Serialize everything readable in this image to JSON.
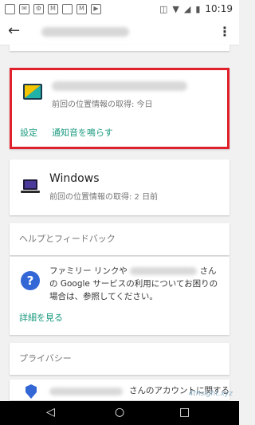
{
  "status_bar": {
    "time": "10:19"
  },
  "device_card_1": {
    "last_location": "前回の位置情報の取得: 今日",
    "settings_link": "設定",
    "ring_link": "通知音を鳴らす"
  },
  "device_card_2": {
    "name": "Windows",
    "last_location": "前回の位置情報の取得: 2 日前"
  },
  "help": {
    "header": "ヘルプとフィードバック",
    "text_part1": "ファミリー リンクや",
    "text_part2": "さんの Google サービスの利用についてお困りの場合は、参照してください。",
    "link": "詳細を見る"
  },
  "privacy": {
    "header": "プライバシー",
    "text": "さんのアカウントに関する"
  },
  "watermark": "4thsight.xyz"
}
